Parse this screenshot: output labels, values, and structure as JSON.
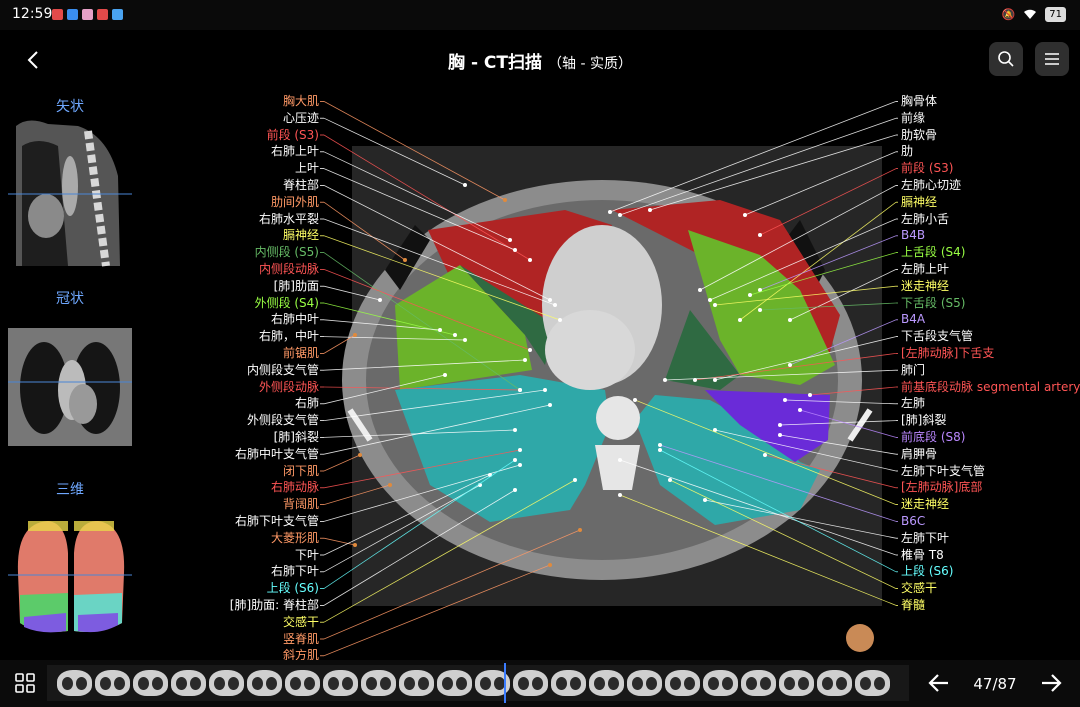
{
  "status": {
    "time": "12:59",
    "battery": "71"
  },
  "header": {
    "title": "胸 - CT扫描",
    "subtitle": "（轴 - 实质）"
  },
  "side": {
    "sagittal": "矢状",
    "coronal": "冠状",
    "three_d": "三维"
  },
  "labels_left": [
    {
      "t": "胸大肌",
      "c": "#ff9966"
    },
    {
      "t": "心压迹",
      "c": "#ffffff"
    },
    {
      "t": "前段 (S3)",
      "c": "#ff5555"
    },
    {
      "t": "右肺上叶",
      "c": "#ffffff"
    },
    {
      "t": "上叶",
      "c": "#ffffff"
    },
    {
      "t": "脊柱部",
      "c": "#ffffff"
    },
    {
      "t": "肋间外肌",
      "c": "#ff9966"
    },
    {
      "t": "右肺水平裂",
      "c": "#ffffff"
    },
    {
      "t": "膈神经",
      "c": "#ffff66"
    },
    {
      "t": "内侧段 (S5)",
      "c": "#66bb66"
    },
    {
      "t": "内侧段动脉",
      "c": "#ff5555"
    },
    {
      "t": "[肺]肋面",
      "c": "#ffffff"
    },
    {
      "t": "外侧段 (S4)",
      "c": "#99ff44"
    },
    {
      "t": "右肺中叶",
      "c": "#ffffff"
    },
    {
      "t": "右肺，中叶",
      "c": "#ffffff"
    },
    {
      "t": "前锯肌",
      "c": "#ff9966"
    },
    {
      "t": "内侧段支气管",
      "c": "#ffffff"
    },
    {
      "t": "外侧段动脉",
      "c": "#ff5555"
    },
    {
      "t": "右肺",
      "c": "#ffffff"
    },
    {
      "t": "外侧段支气管",
      "c": "#ffffff"
    },
    {
      "t": "[肺]斜裂",
      "c": "#ffffff"
    },
    {
      "t": "右肺中叶支气管",
      "c": "#ffffff"
    },
    {
      "t": "闭下肌",
      "c": "#ff9966"
    },
    {
      "t": "右肺动脉",
      "c": "#ff5555"
    },
    {
      "t": "背阔肌",
      "c": "#ff9966"
    },
    {
      "t": "右肺下叶支气管",
      "c": "#ffffff"
    },
    {
      "t": "大菱形肌",
      "c": "#ff9966"
    },
    {
      "t": "下叶",
      "c": "#ffffff"
    },
    {
      "t": "右肺下叶",
      "c": "#ffffff"
    },
    {
      "t": "上段 (S6)",
      "c": "#66ffff"
    },
    {
      "t": "[肺]肋面: 脊柱部",
      "c": "#ffffff"
    },
    {
      "t": "交感干",
      "c": "#ffff66"
    },
    {
      "t": "竖脊肌",
      "c": "#ff9966"
    },
    {
      "t": "斜方肌",
      "c": "#ff9966"
    }
  ],
  "labels_right": [
    {
      "t": "胸骨体",
      "c": "#ffffff"
    },
    {
      "t": "前缘",
      "c": "#ffffff"
    },
    {
      "t": "肋软骨",
      "c": "#ffffff"
    },
    {
      "t": "肋",
      "c": "#ffffff"
    },
    {
      "t": "前段 (S3)",
      "c": "#ff5555"
    },
    {
      "t": "左肺心切迹",
      "c": "#ffffff"
    },
    {
      "t": "膈神经",
      "c": "#ffff66"
    },
    {
      "t": "左肺小舌",
      "c": "#ffffff"
    },
    {
      "t": "B4B",
      "c": "#bb99ff"
    },
    {
      "t": "上舌段 (S4)",
      "c": "#99ff44"
    },
    {
      "t": "左肺上叶",
      "c": "#ffffff"
    },
    {
      "t": "迷走神经",
      "c": "#ffff66"
    },
    {
      "t": "下舌段 (S5)",
      "c": "#66bb66"
    },
    {
      "t": "B4A",
      "c": "#bb99ff"
    },
    {
      "t": "下舌段支气管",
      "c": "#ffffff"
    },
    {
      "t": "[左肺动脉]下舌支",
      "c": "#ff5555"
    },
    {
      "t": "肺门",
      "c": "#ffffff"
    },
    {
      "t": "前基底段动脉 segmental artery",
      "c": "#ff5555"
    },
    {
      "t": "左肺",
      "c": "#ffffff"
    },
    {
      "t": "[肺]斜裂",
      "c": "#ffffff"
    },
    {
      "t": "前底段 (S8)",
      "c": "#bb88ff"
    },
    {
      "t": "肩胛骨",
      "c": "#ffffff"
    },
    {
      "t": "左肺下叶支气管",
      "c": "#ffffff"
    },
    {
      "t": "[左肺动脉]底部",
      "c": "#ff5555"
    },
    {
      "t": "迷走神经",
      "c": "#ffff66"
    },
    {
      "t": "B6C",
      "c": "#bb99ff"
    },
    {
      "t": "左肺下叶",
      "c": "#ffffff"
    },
    {
      "t": "椎骨 T8",
      "c": "#ffffff"
    },
    {
      "t": "上段 (S6)",
      "c": "#66ffff"
    },
    {
      "t": "交感干",
      "c": "#ffff66"
    },
    {
      "t": "脊髓",
      "c": "#ffff66"
    }
  ],
  "pagination": {
    "current": "47/87"
  }
}
